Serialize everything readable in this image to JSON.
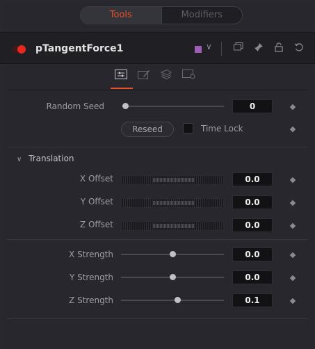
{
  "tabs": {
    "tools": "Tools",
    "modifiers": "Modifiers"
  },
  "header": {
    "tool_name": "pTangentForce1",
    "color_swatch": "#9c5fb5",
    "icons": [
      "chevron-down-icon",
      "window-icon",
      "pin-icon",
      "lock-icon",
      "reset-icon"
    ]
  },
  "icon_tabs": [
    "controls-icon",
    "style-icon",
    "image-icon",
    "settings-icon"
  ],
  "random": {
    "seed_label": "Random Seed",
    "seed_value": "0",
    "seed_slider": 0,
    "reseed_label": "Reseed",
    "timelock_label": "Time Lock",
    "timelock_checked": false
  },
  "translation": {
    "title": "Translation",
    "x_label": "X Offset",
    "x_value": "0.0",
    "y_label": "Y Offset",
    "y_value": "0.0",
    "z_label": "Z Offset",
    "z_value": "0.0"
  },
  "strength": {
    "x_label": "X Strength",
    "x_value": "0.0",
    "x_slider": 0.5,
    "y_label": "Y Strength",
    "y_value": "0.0",
    "y_slider": 0.5,
    "z_label": "Z Strength",
    "z_value": "0.1",
    "z_slider": 0.55
  },
  "colors": {
    "accent": "#e8502c",
    "toggle_on": "#e8281e"
  }
}
